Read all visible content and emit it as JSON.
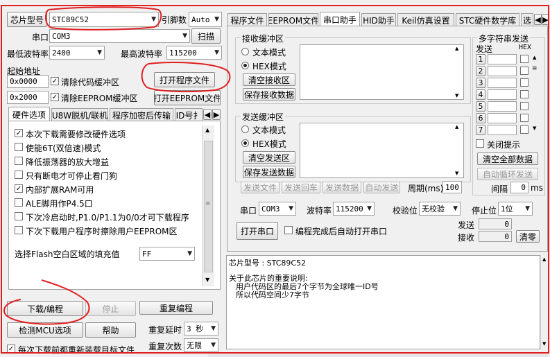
{
  "left": {
    "mcu_label": "芯片型号",
    "mcu_value": "STC89C52",
    "pins_label": "引脚数",
    "pins_value": "Auto",
    "port_label": "串口",
    "port_value": "COM3",
    "scan_button": "扫描",
    "min_baud_label": "最低波特率",
    "min_baud_value": "2400",
    "max_baud_label": "最高波特率",
    "max_baud_value": "115200",
    "start_addr_label": "起始地址",
    "addr1": "0x0000",
    "clear_code_label": "清除代码缓冲区",
    "open_program_button": "打开程序文件",
    "addr2": "0x2000",
    "clear_eeprom_label": "清除EEPROM缓冲区",
    "open_eeprom_button": "打开EEPROM文件",
    "tabs": [
      "硬件选项",
      "U8W脱机/联机",
      "程序加密后传输",
      "ID号扌"
    ],
    "options": [
      {
        "label": "本次下载需要修改硬件选项",
        "checked": true
      },
      {
        "label": "使能6T(双倍速)模式",
        "checked": false
      },
      {
        "label": "降低振荡器的放大增益",
        "checked": false
      },
      {
        "label": "只有断电才可停止看门狗",
        "checked": false
      },
      {
        "label": "内部扩展RAM可用",
        "checked": true
      },
      {
        "label": "ALE脚用作P4.5口",
        "checked": false
      },
      {
        "label": "下次冷启动时,P1.0/P1.1为0/0才可下载程序",
        "checked": false
      },
      {
        "label": "下次下载用户程序时擦除用户EEPROM区",
        "checked": false
      }
    ],
    "fill_label": "选择Flash空白区域的填充值",
    "fill_value": "FF",
    "download_button": "下载/编程",
    "stop_button": "停止",
    "reprogram_button": "重复编程",
    "detect_button": "检测MCU选项",
    "help_button": "帮助",
    "repeat_delay_label": "重复延时",
    "repeat_delay_value": "3 秒",
    "reload_label": "每次下载前都重新装载目标文件",
    "repeat_count_label": "重复次数",
    "repeat_count_value": "无限"
  },
  "right": {
    "tabs": [
      "程序文件",
      "EEPROM文件",
      "串口助手",
      "HID助手",
      "Keil仿真设置",
      "STC硬件数学库",
      "选"
    ],
    "active_tab": 2,
    "recv_group": "接收缓冲区",
    "text_mode": "文本模式",
    "hex_mode": "HEX模式",
    "clear_recv": "清空接收区",
    "save_recv": "保存接收数据",
    "send_group": "发送缓冲区",
    "clear_send": "清空发送区",
    "save_send": "保存发送数据",
    "send_file": "发送文件",
    "send_enter": "发送回车",
    "send_data": "发送数据",
    "auto_send": "自动发送",
    "period_label": "周期(ms)",
    "period_value": "100",
    "multi_title": "多字符串发送",
    "send_header": "发送",
    "hex_header": "HEX",
    "multi_items": [
      "1",
      "2",
      "3",
      "4",
      "5",
      "6",
      "7"
    ],
    "close_hint": "关闭提示",
    "clear_all": "清空全部数据",
    "auto_loop": "自动循环发送",
    "interval_label": "间隔",
    "interval_value": "0",
    "interval_unit": "ms",
    "port_label": "串口",
    "port_value": "COM3",
    "baud_label": "波特率",
    "baud_value": "115200",
    "parity_label": "校验位",
    "parity_value": "无校验",
    "stop_label": "停止位",
    "stop_value": "1位",
    "open_port": "打开串口",
    "auto_open_label": "编程完成后自动打开串口",
    "sent_label": "发送",
    "sent_value": "0",
    "recv_label": "接收",
    "recv_value": "0",
    "clear_counts": "清零"
  },
  "log": {
    "line1": "芯片型号 : STC89C52",
    "line2": "关于此芯片的重要说明:",
    "line3": "用户代码区的最后7个字节为全球唯一ID号",
    "line4": "所以代码空间少7字节"
  },
  "colors": {
    "annotation": "#e02020"
  }
}
